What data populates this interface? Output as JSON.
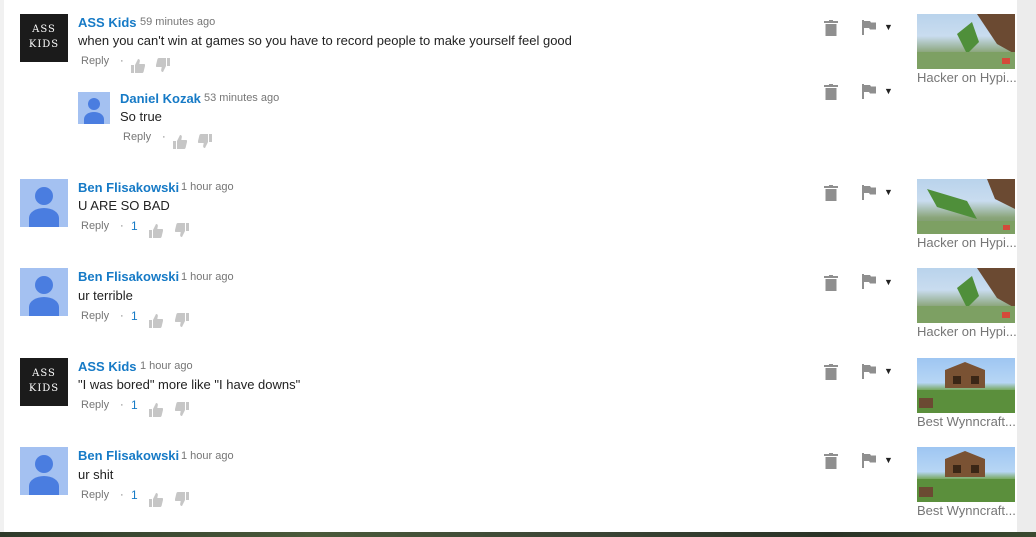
{
  "comments": [
    {
      "author": "ASS Kids",
      "time": "59 minutes ago",
      "text": "when you can't win at games so you have to record people to make yourself feel good",
      "reply_label": "Reply",
      "likes": "",
      "avatar": "ass-kids-logo",
      "avatar_text_1": "ASS",
      "avatar_text_2": "KIDS",
      "video_title": "Hacker on Hypi..."
    },
    {
      "author": "Daniel Kozak",
      "time": "53 minutes ago",
      "text": "So true",
      "reply_label": "Reply",
      "likes": "",
      "avatar": "default-user-avatar"
    },
    {
      "author": "Ben Flisakowski",
      "time": "1 hour ago",
      "text": "U ARE SO BAD",
      "reply_label": "Reply",
      "likes": "1",
      "avatar": "default-user-avatar",
      "video_title": "Hacker on Hypi..."
    },
    {
      "author": "Ben Flisakowski",
      "time": "1 hour ago",
      "text": "ur terrible",
      "reply_label": "Reply",
      "likes": "1",
      "avatar": "default-user-avatar",
      "video_title": "Hacker on Hypi..."
    },
    {
      "author": "ASS Kids",
      "time": "1 hour ago",
      "text": "\"I was bored\" more like \"I have downs\"",
      "reply_label": "Reply",
      "likes": "1",
      "avatar": "ass-kids-logo",
      "avatar_text_1": "ASS",
      "avatar_text_2": "KIDS",
      "video_title": "Best Wynncraft..."
    },
    {
      "author": "Ben Flisakowski",
      "time": "1 hour ago",
      "text": "ur shit",
      "reply_label": "Reply",
      "likes": "1",
      "avatar": "default-user-avatar",
      "video_title": "Best Wynncraft..."
    }
  ],
  "separator": "·",
  "icons": {
    "trash": "trash-icon",
    "flag": "flag-icon",
    "menu": "chevron-down-icon",
    "like": "thumbs-up-icon",
    "dislike": "thumbs-down-icon"
  },
  "colors": {
    "author": "#167ac6",
    "meta": "#767676",
    "text": "#222222",
    "avatar_bg": "#a4c1f1",
    "avatar_fg": "#4a7de0"
  }
}
